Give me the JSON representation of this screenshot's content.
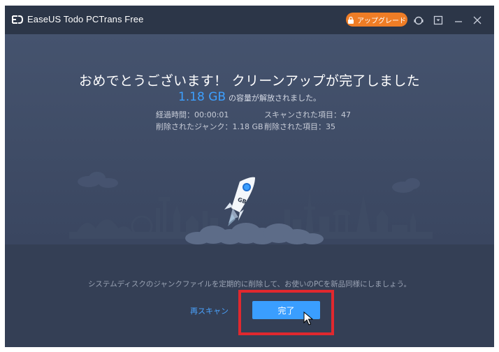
{
  "window": {
    "title": "EaseUS Todo PCTrans Free",
    "upgrade_label": "アップグレード"
  },
  "result": {
    "headline": "おめでとうございます！ クリーンアップが完了しました",
    "freed_size": "1.18 GB",
    "freed_text": "の容量が解放されました。",
    "stats": {
      "elapsed": "経過時間：00:00:01",
      "scanned": "スキャンされた項目：47",
      "junk_removed": "削除されたジャンク：1.18 GB",
      "items_removed": "削除された項目：35"
    },
    "rocket_label": "GB"
  },
  "footer": {
    "tip": "システムディスクのジャンクファイルを定期的に削除して、お使いのPCを新品同様にしましょう。",
    "rescan_label": "再スキャン",
    "done_label": "完了"
  },
  "colors": {
    "accent": "#3a9eff",
    "upgrade": "#ef7d26",
    "highlight": "#e0282e"
  },
  "icons": [
    "app-logo-icon",
    "lock-icon",
    "support-icon",
    "minimize-to-tray-icon",
    "minimize-icon",
    "close-icon",
    "rocket-icon"
  ]
}
